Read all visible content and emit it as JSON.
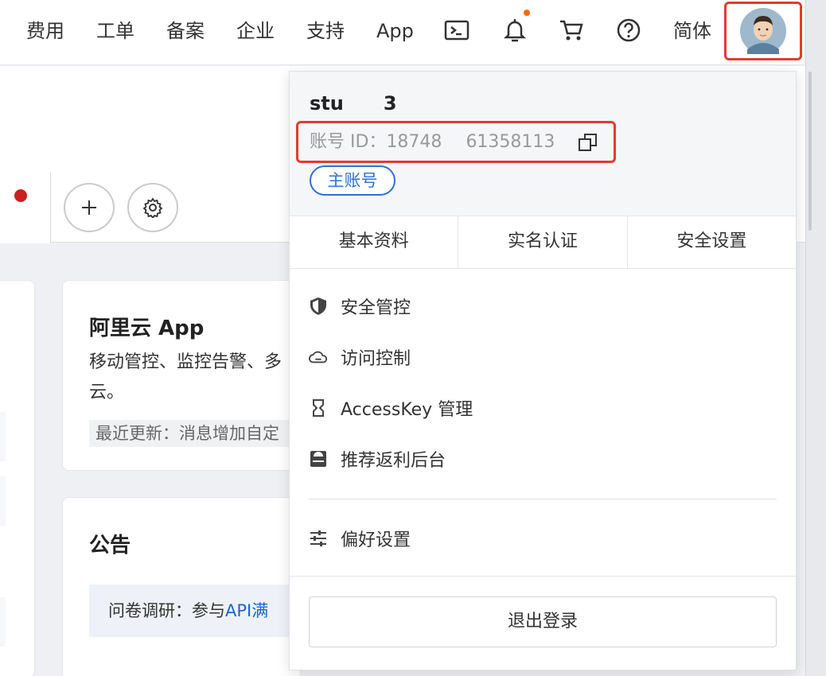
{
  "topbar": {
    "nav": [
      "费用",
      "工单",
      "备案",
      "企业",
      "支持",
      "App"
    ],
    "language": "简体",
    "icons": [
      "terminal-icon",
      "bell-icon",
      "cart-icon",
      "help-icon",
      "avatar"
    ]
  },
  "background": {
    "app_card": {
      "title": "阿里云 App",
      "desc_line1": "移动管控、监控告警、多",
      "desc_line2": "云。",
      "update": "最近更新：消息增加自定"
    },
    "notice_card": {
      "title": "公告",
      "survey_prefix": "问卷调研：参与",
      "survey_link": "API满"
    }
  },
  "account": {
    "username_start": "stu",
    "username_tail": "3",
    "id_label": "账号 ID：",
    "id_part1": "18748",
    "id_part2": "61358113",
    "role": "主账号"
  },
  "profile_tabs": [
    "基本资料",
    "实名认证",
    "安全设置"
  ],
  "menu": {
    "security_control": "安全管控",
    "access_control": "访问控制",
    "accesskey": "AccessKey 管理",
    "referral": "推荐返利后台",
    "preferences": "偏好设置"
  },
  "logout": "退出登录",
  "colors": {
    "highlight_red": "#e23b2e",
    "brand_blue": "#2f6fd6",
    "notification_dot": "#ff6a00"
  }
}
